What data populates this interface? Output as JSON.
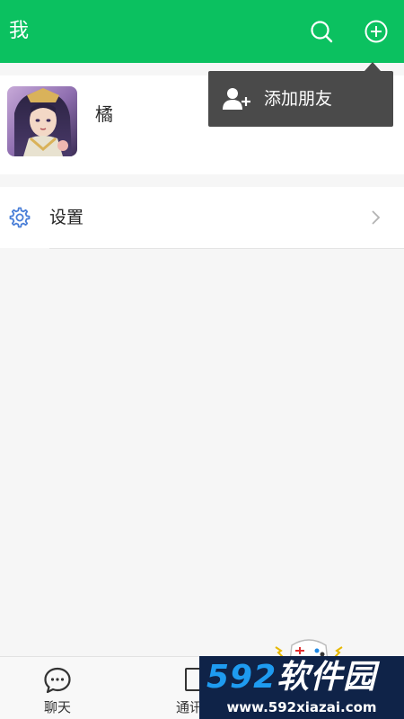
{
  "header": {
    "title": "我",
    "background": "#0bc160",
    "search_icon": "search-icon",
    "add_icon": "plus-circle-icon"
  },
  "profile": {
    "name": "橘",
    "avatar_icon": "avatar"
  },
  "settings_row": {
    "label": "设置",
    "icon": "gear-icon",
    "accent": "#4a7fd8"
  },
  "popup_menu": {
    "item_label": "添加朋友",
    "item_icon": "add-friend-icon",
    "background": "#4a4a4a"
  },
  "tabbar": {
    "tabs": [
      {
        "label": "聊天",
        "icon": "chat-bubble-icon"
      },
      {
        "label": "通讯",
        "icon": "contacts-icon"
      }
    ]
  },
  "watermark": {
    "number": "592",
    "text": "软件园",
    "url": "www.592xiazai.com"
  }
}
